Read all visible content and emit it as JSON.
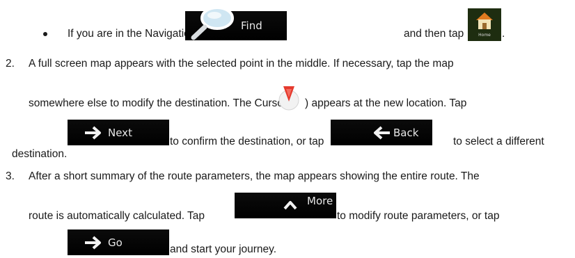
{
  "bullet": {
    "text_before": "If you are in the Navigation menu, tap",
    "text_middle": "and then tap",
    "period": "."
  },
  "buttons": {
    "find": "Find",
    "home": "Home",
    "next": "Next",
    "back": "Back",
    "more": "More",
    "go": "Go"
  },
  "step2": {
    "number": "2.",
    "line1": "A full screen map appears with the selected point in the middle. If necessary, tap the map",
    "line2_a": "somewhere else to modify the destination. The Cursor (",
    "line2_b": ") appears at the new location. Tap",
    "line3_a": "to confirm the destination, or tap",
    "line3_b": "to select a different",
    "line4": "destination."
  },
  "step3": {
    "number": "3.",
    "line1": "After a short summary of the route parameters, the map appears showing the entire route. The",
    "line2_a": "route is automatically calculated. Tap",
    "line2_b": "to modify route parameters, or tap",
    "line3": "and start your journey."
  }
}
